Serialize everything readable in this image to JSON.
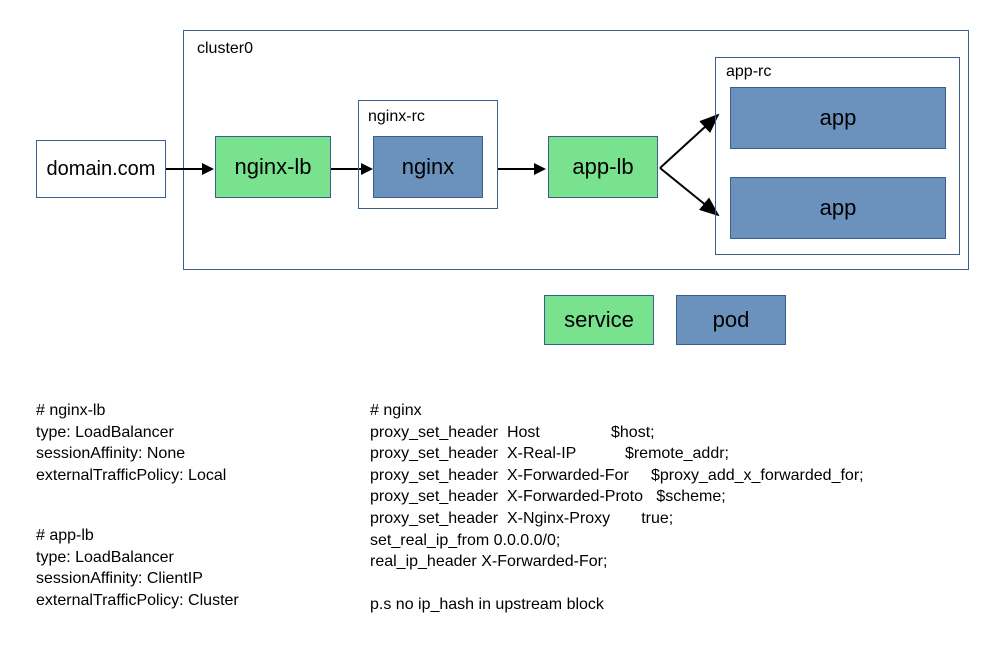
{
  "diagram": {
    "domain": "domain.com",
    "cluster_label": "cluster0",
    "nginx_lb": "nginx-lb",
    "nginx_rc_label": "nginx-rc",
    "nginx": "nginx",
    "app_lb": "app-lb",
    "app_rc_label": "app-rc",
    "app1": "app",
    "app2": "app"
  },
  "legend": {
    "service": "service",
    "pod": "pod"
  },
  "config": {
    "nginx_lb_block": "# nginx-lb\ntype: LoadBalancer\nsessionAffinity: None\nexternalTrafficPolicy: Local",
    "app_lb_block": "# app-lb\ntype: LoadBalancer\nsessionAffinity: ClientIP\nexternalTrafficPolicy: Cluster",
    "nginx_block": "# nginx\nproxy_set_header  Host                $host;\nproxy_set_header  X-Real-IP           $remote_addr;\nproxy_set_header  X-Forwarded-For     $proxy_add_x_forwarded_for;\nproxy_set_header  X-Forwarded-Proto   $scheme;\nproxy_set_header  X-Nginx-Proxy       true;\nset_real_ip_from 0.0.0.0/0;\nreal_ip_header X-Forwarded-For;\n\np.s no ip_hash in upstream block"
  }
}
